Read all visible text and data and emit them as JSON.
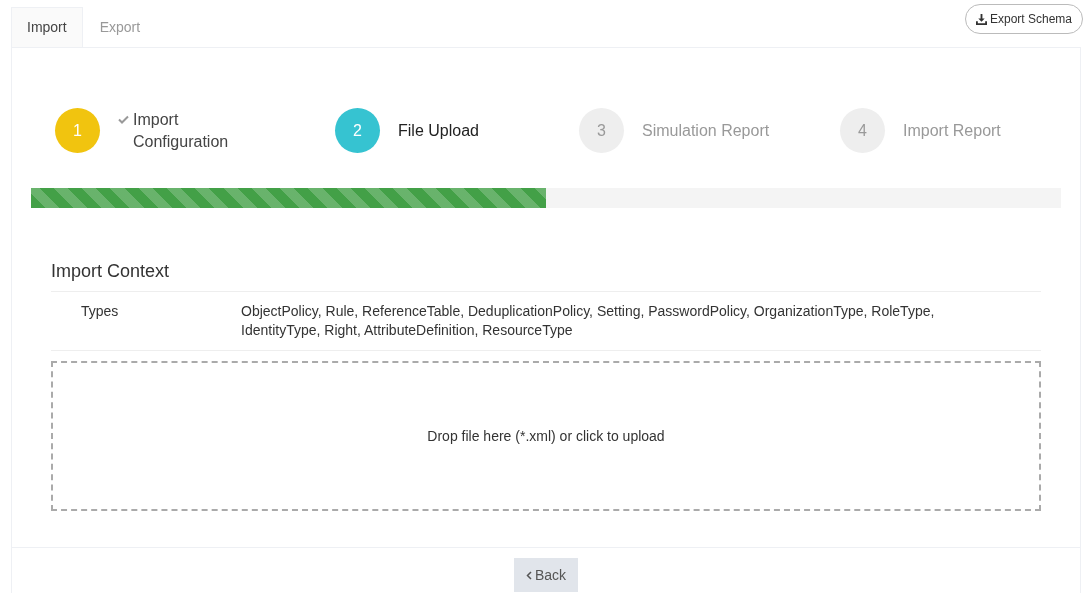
{
  "tabs": [
    {
      "label": "Import",
      "selected": true
    },
    {
      "label": "Export",
      "selected": false
    }
  ],
  "export_button": "Export Schema",
  "steps": [
    {
      "number": "1",
      "label": "Import Configuration",
      "selected": false,
      "completed": true,
      "color": "#f1c40f"
    },
    {
      "number": "2",
      "label": "File Upload",
      "selected": true,
      "completed": false,
      "color": "#36c3d1"
    },
    {
      "number": "3",
      "label": "Simulation Report",
      "selected": false,
      "completed": false,
      "color": "#eeeeee"
    },
    {
      "number": "4",
      "label": "Import Report",
      "selected": false,
      "completed": false,
      "color": "#eeeeee"
    }
  ],
  "progress": {
    "level": 0.5
  },
  "context": {
    "title": "Import Context",
    "rows": [
      {
        "label": "Types",
        "value": "ObjectPolicy, Rule, ReferenceTable, DeduplicationPolicy, Setting, PasswordPolicy, OrganizationType, RoleType, IdentityType, Right, AttributeDefinition, ResourceType"
      }
    ]
  },
  "dropzone": "Drop file here (*.xml) or click to upload",
  "back_button": "Back"
}
